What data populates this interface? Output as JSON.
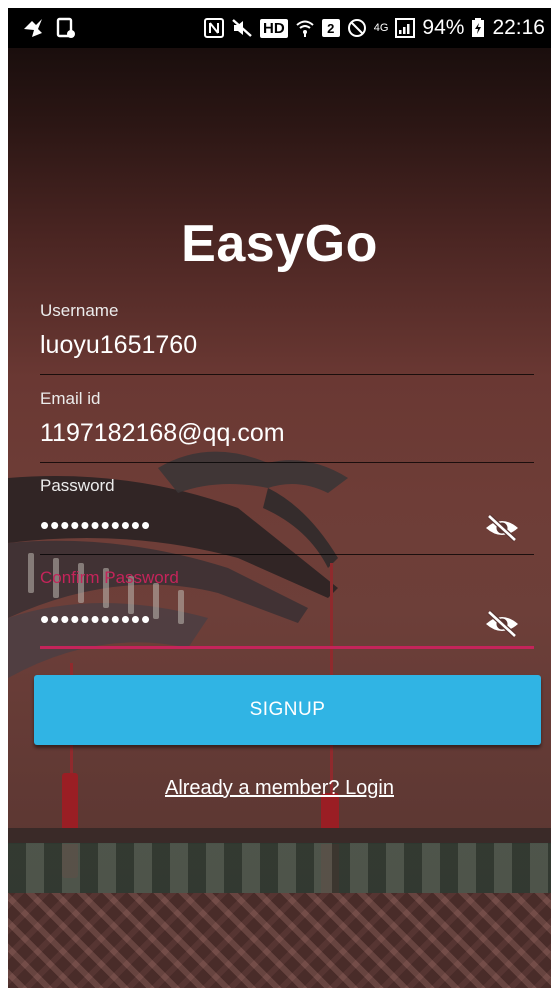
{
  "status_bar": {
    "hd": "HD",
    "sim_slot": "2",
    "network": "4G",
    "battery": "94%",
    "time": "22:16",
    "icons": [
      "notification-bird-icon",
      "screenshot-icon",
      "nfc-icon",
      "mute-icon",
      "wifi-icon",
      "do-not-disturb-icon",
      "signal-icon",
      "battery-icon"
    ]
  },
  "app": {
    "title": "EasyGo"
  },
  "form": {
    "username": {
      "label": "Username",
      "value": "luoyu1651760"
    },
    "email": {
      "label": "Email id",
      "value": "1197182168@qq.com"
    },
    "password": {
      "label": "Password",
      "value": "•••••••••••"
    },
    "confirm_password": {
      "label": "Confirm Password",
      "value": "•••••••••••"
    }
  },
  "actions": {
    "signup_label": "SIGNUP",
    "login_link": "Already a member? Login"
  },
  "colors": {
    "primary": "#30b4e4",
    "accent": "#c4245a"
  }
}
